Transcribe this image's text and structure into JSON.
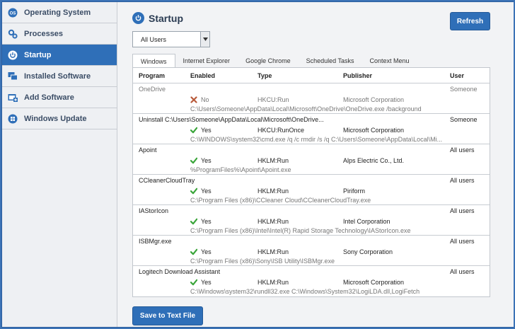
{
  "sidebar": {
    "items": [
      {
        "label": "Operating System",
        "icon": "os-badge-icon",
        "active": false
      },
      {
        "label": "Processes",
        "icon": "gears-icon",
        "active": false
      },
      {
        "label": "Startup",
        "icon": "power-icon",
        "active": true
      },
      {
        "label": "Installed Software",
        "icon": "windows-stack-icon",
        "active": false
      },
      {
        "label": "Add Software",
        "icon": "window-add-icon",
        "active": false
      },
      {
        "label": "Windows Update",
        "icon": "windows-logo-icon",
        "active": false
      }
    ]
  },
  "header": {
    "title": "Startup",
    "refresh_label": "Refresh"
  },
  "filter": {
    "selected": "All Users"
  },
  "tabs": [
    "Windows",
    "Internet Explorer",
    "Google Chrome",
    "Scheduled Tasks",
    "Context Menu"
  ],
  "table": {
    "columns": {
      "program": "Program",
      "enabled": "Enabled",
      "type": "Type",
      "publisher": "Publisher",
      "user": "User"
    },
    "rows": [
      {
        "program": "OneDrive",
        "enabled": "No",
        "type": "HKCU:Run",
        "publisher": "Microsoft Corporation",
        "user": "Someone",
        "command": "C:\\Users\\Someone\\AppData\\Local\\Microsoft\\OneDrive\\OneDrive.exe /background",
        "is_enabled": false
      },
      {
        "program": "Uninstall C:\\Users\\Someone\\AppData\\Local\\Microsoft\\OneDrive...",
        "enabled": "Yes",
        "type": "HKCU:RunOnce",
        "publisher": "Microsoft Corporation",
        "user": "Someone",
        "command": "C:\\WINDOWS\\system32\\cmd.exe /q /c rmdir /s /q C:\\Users\\Someone\\AppData\\Local\\Mi...",
        "is_enabled": true
      },
      {
        "program": "Apoint",
        "enabled": "Yes",
        "type": "HKLM:Run",
        "publisher": "Alps Electric Co., Ltd.",
        "user": "All users",
        "command": "%ProgramFiles%\\Apoint\\Apoint.exe",
        "is_enabled": true
      },
      {
        "program": "CCleanerCloudTray",
        "enabled": "Yes",
        "type": "HKLM:Run",
        "publisher": "Piriform",
        "user": "All users",
        "command": "C:\\Program Files (x86)\\CCleaner Cloud\\CCleanerCloudTray.exe",
        "is_enabled": true
      },
      {
        "program": "IAStorIcon",
        "enabled": "Yes",
        "type": "HKLM:Run",
        "publisher": "Intel Corporation",
        "user": "All users",
        "command": "C:\\Program Files (x86)\\Intel\\Intel(R) Rapid Storage Technology\\IAStorIcon.exe",
        "is_enabled": true
      },
      {
        "program": "ISBMgr.exe",
        "enabled": "Yes",
        "type": "HKLM:Run",
        "publisher": "Sony Corporation",
        "user": "All users",
        "command": "C:\\Program Files (x86)\\Sony\\ISB Utility\\ISBMgr.exe",
        "is_enabled": true
      },
      {
        "program": "Logitech Download Assistant",
        "enabled": "Yes",
        "type": "HKLM:Run",
        "publisher": "Microsoft Corporation",
        "user": "All users",
        "command": "C:\\Windows\\system32\\rundll32.exe C:\\Windows\\System32\\LogiLDA.dll,LogiFetch",
        "is_enabled": true
      }
    ]
  },
  "footer": {
    "save_label": "Save to Text File"
  },
  "colors": {
    "accent": "#2f6fb8",
    "check": "#3aa53a",
    "cross": "#b85a3a"
  }
}
